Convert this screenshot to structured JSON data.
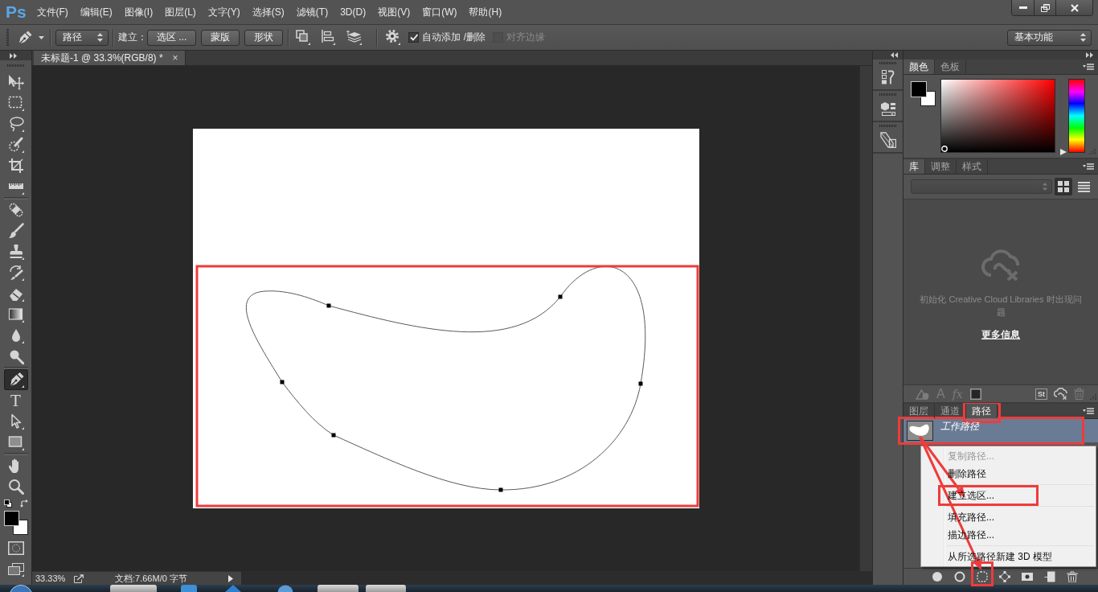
{
  "app_logo": "Ps",
  "menu_bar": [
    "文件(F)",
    "编辑(E)",
    "图像(I)",
    "图层(L)",
    "文字(Y)",
    "选择(S)",
    "滤镜(T)",
    "3D(D)",
    "视图(V)",
    "窗口(W)",
    "帮助(H)"
  ],
  "options_bar": {
    "tool_mode": "路径",
    "make_label": "建立：",
    "make_buttons": [
      "选区 ...",
      "蒙版",
      "形状"
    ],
    "checkboxes": [
      {
        "label": "自动添加 /删除",
        "checked": true,
        "disabled": false
      },
      {
        "label": "对齐边缘",
        "checked": false,
        "disabled": true
      }
    ],
    "workspace": "基本功能"
  },
  "toolbar": {
    "groups": [
      [
        {
          "kind": "move",
          "selected": false
        },
        {
          "kind": "marquee",
          "selected": false
        },
        {
          "kind": "lasso",
          "selected": false
        },
        {
          "kind": "quick-select",
          "selected": false
        },
        {
          "kind": "crop",
          "selected": false
        },
        {
          "kind": "ruler",
          "selected": false
        }
      ],
      [
        {
          "kind": "healing",
          "selected": false
        },
        {
          "kind": "brush",
          "selected": false
        },
        {
          "kind": "stamp",
          "selected": false
        },
        {
          "kind": "history-brush",
          "selected": false
        },
        {
          "kind": "eraser",
          "selected": false
        },
        {
          "kind": "gradient",
          "selected": false
        },
        {
          "kind": "blur",
          "selected": false
        },
        {
          "kind": "dodge",
          "selected": false
        }
      ],
      [
        {
          "kind": "pen",
          "selected": true
        },
        {
          "kind": "type",
          "label": "T",
          "selected": false
        },
        {
          "kind": "path-select",
          "selected": false
        },
        {
          "kind": "shape",
          "selected": false
        }
      ],
      [
        {
          "kind": "hand",
          "selected": false
        },
        {
          "kind": "zoom",
          "selected": false
        }
      ]
    ]
  },
  "document": {
    "tab_title": "未标题-1 @ 33.3%(RGB/8) *",
    "tab_close": "×",
    "annotated": true
  },
  "status_bar": {
    "zoom": "33.33%",
    "info": "文档:7.66M/0 字节"
  },
  "color_panel": {
    "tabs": [
      {
        "label": "颜色",
        "selected": true
      },
      {
        "label": "色板",
        "selected": false
      }
    ],
    "hue_slider": {
      "level": 0
    }
  },
  "library_panel": {
    "tabs": [
      {
        "label": "库",
        "selected": true
      },
      {
        "label": "调整",
        "selected": false
      },
      {
        "label": "样式",
        "selected": false
      }
    ],
    "view_modes": [
      {
        "kind": "grid",
        "selected": true
      },
      {
        "kind": "list",
        "selected": false
      }
    ],
    "message": "初始化 Creative Cloud Libraries 时出现问题",
    "link": "更多信息",
    "footer_left": [
      {
        "kind": "graphic"
      },
      {
        "kind": "character-style",
        "label": "A"
      },
      {
        "kind": "layer-style",
        "label": "fx"
      },
      {
        "kind": "fill-color"
      }
    ],
    "footer_right": [
      {
        "kind": "stock",
        "label": "St"
      },
      {
        "kind": "sync"
      },
      {
        "kind": "trash"
      }
    ]
  },
  "paths_panel": {
    "tabs": [
      {
        "label": "图层",
        "selected": false,
        "annotated": false
      },
      {
        "label": "通道",
        "selected": false,
        "annotated": false
      },
      {
        "label": "路径",
        "selected": true,
        "annotated": true
      }
    ],
    "rows": [
      {
        "name": "工作路径",
        "selected": true,
        "annotated": true
      }
    ],
    "context_menu": {
      "groups": [
        [
          {
            "label": "复制路径...",
            "disabled": true,
            "annotated": false,
            "arrow": false
          },
          {
            "label": "删除路径",
            "disabled": false,
            "annotated": false,
            "arrow": false
          }
        ],
        [
          {
            "label": "建立选区...",
            "disabled": false,
            "annotated": true,
            "arrow": true
          }
        ],
        [
          {
            "label": "填充路径...",
            "disabled": false,
            "annotated": false,
            "arrow": false
          },
          {
            "label": "描边路径...",
            "disabled": false,
            "annotated": false,
            "arrow": false
          }
        ],
        [
          {
            "label": "从所选路径新建 3D 模型",
            "disabled": false,
            "annotated": false,
            "arrow": false
          }
        ]
      ]
    },
    "footer": [
      {
        "kind": "fill",
        "annotated": false,
        "arrow": false
      },
      {
        "kind": "stroke",
        "annotated": false,
        "arrow": false
      },
      {
        "kind": "selection",
        "annotated": true,
        "arrow": true
      },
      {
        "kind": "work-path",
        "annotated": false,
        "arrow": false
      },
      {
        "kind": "mask",
        "annotated": false,
        "arrow": false
      },
      {
        "kind": "new",
        "annotated": false,
        "arrow": false
      },
      {
        "kind": "trash",
        "annotated": false,
        "arrow": false
      }
    ]
  }
}
